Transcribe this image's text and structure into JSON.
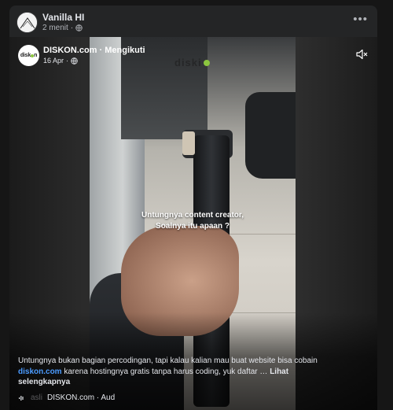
{
  "post": {
    "author": "Vanilla HI",
    "time": "2 menit",
    "more_icon": "ellipsis-icon"
  },
  "reel": {
    "page_name": "DISKON.com",
    "follow_status": "Mengikuti",
    "separator": " · ",
    "date": "16 Apr",
    "avatar_text_a": "disk",
    "avatar_text_b": "n",
    "watermark": "diski",
    "overlay_line1": "Untungnya content creator,",
    "overlay_line2": "Soalnya itu apaan ?",
    "mute_icon": "speaker-muted-icon",
    "description_pre": "Untungnya bukan bagian percodingan, tapi kalau kalian mau buat website bisa cobain ",
    "description_link": "diskon.com",
    "description_post": " karena hostingnya gratis tanpa harus coding, yuk daftar … ",
    "see_more": "Lihat selengkapnya",
    "audio_icon": "audio-wave-icon",
    "audio_faded": "asli",
    "audio_text": "DISKON.com · Aud"
  }
}
